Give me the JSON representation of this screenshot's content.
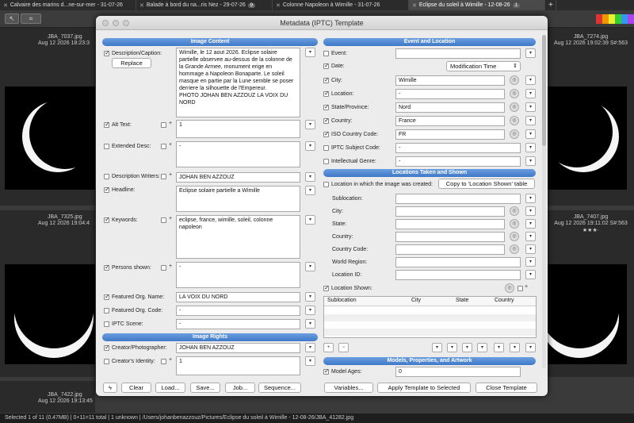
{
  "tabs": [
    {
      "label": "Calvaire des marins d...ne-sur-mer - 31-07-26",
      "count": ""
    },
    {
      "label": "Balade à bord du na...ris Nez - 29-07-26",
      "count": "9"
    },
    {
      "label": "Colonne Napoleon à Wimille - 31-07-26",
      "count": ""
    },
    {
      "label": "Eclipse du soleil à Wimille - 12-08-26",
      "count": "1"
    }
  ],
  "thumbs": {
    "tl": {
      "name": "JBA_7037.jpg",
      "date": "Aug 12 2026 18:23:3"
    },
    "tr": {
      "name": "JBA_7274.jpg",
      "date": "Aug 12 2026 19:02:39 S#:563"
    },
    "ml": {
      "name": "JBA_7325.jpg",
      "date": "Aug 12 2026 19:04:4"
    },
    "mr": {
      "name": "JBA_7407.jpg",
      "date": "Aug 12 2026 19:11:02 S#:563"
    },
    "bl": {
      "name": "JBA_7422.jpg",
      "date": "Aug 12 2026 19:13:45"
    },
    "stars": "★★★·"
  },
  "dialog": {
    "title": "Metadata (IPTC) Template",
    "sections": {
      "content": "Image Content",
      "event": "Event and Location",
      "rights": "Image Rights",
      "locations": "Locations Taken and Shown",
      "models": "Models, Properties, and Artwork"
    },
    "left": {
      "description_label": "Description/Caption:",
      "replace": "Replace",
      "description": "Wimille, le 12 aout 2026. Eclipse solaire partielle observee au-dessus de la colonne de la Grande Armee, monument erige en hommage a Napoleon Bonaparte. Le soleil masque en partie par la Lune semble se poser derriere la silhouette de l'Empereur.\nPHOTO JOHAN BEN AZZOUZ LA VOIX DU NORD",
      "alt_label": "Alt Text:",
      "alt": "1",
      "ext_label": "Extended Desc:",
      "ext": "-",
      "writers_label": "Description Writers:",
      "writers": "JOHAN BEN AZZOUZ",
      "headline_label": "Headline:",
      "headline": "Eclipse solaire partielle a Wimille",
      "keywords_label": "Keywords:",
      "keywords": "eclipse, france, wimille, soleil, colonne napoleon",
      "persons_label": "Persons shown:",
      "persons": "-",
      "org_label": "Featured Org. Name:",
      "org": "LA VOIX DU NORD",
      "orgcode_label": "Featured Org. Code:",
      "orgcode": "-",
      "scene_label": "IPTC Scene:",
      "scene": "-",
      "creator_label": "Creator/Photographer:",
      "creator": "JOHAN BEN AZZOUZ",
      "identity_label": "Creator's Identity:",
      "identity": "1"
    },
    "right": {
      "event_label": "Event:",
      "event": "",
      "date_label": "Date:",
      "date": "Modification Time",
      "city_label": "City:",
      "city": "Wimille",
      "location_label": "Location:",
      "location": "-",
      "state_label": "State/Province:",
      "state": "Nord",
      "country_label": "Country:",
      "country": "France",
      "iso_label": "ISO Country Code:",
      "iso": "FR",
      "subject_label": "IPTC Subject Code:",
      "subject": "-",
      "genre_label": "Intellectual Genre:",
      "genre": "-",
      "created_label": "Location in which the image was created:",
      "copy_btn": "Copy to 'Location Shown' table",
      "sub_label": "Sublocation:",
      "city2_label": "City:",
      "state2_label": "State:",
      "country2_label": "Country:",
      "ccode_label": "Country Code:",
      "region_label": "World Region:",
      "locid_label": "Location ID:",
      "shown_label": "Location Shown:",
      "cols": [
        "Sublocation",
        "City",
        "State",
        "Country"
      ],
      "ages_label": "Model Ages:",
      "ages": "0"
    },
    "buttons": {
      "clear": "Clear",
      "load": "Load...",
      "save": "Save...",
      "job": "Job...",
      "sequence": "Sequence...",
      "variables": "Variables...",
      "apply": "Apply Template to Selected",
      "close": "Close Template"
    }
  },
  "status": "Selected 1 of 11 (0.47MB) | 0+11=11 total | 1 unknown | /Users/johanbenazzouz/Pictures/Eclipse du soleil à Wimille - 12-08-26/JBA_41282.jpg"
}
